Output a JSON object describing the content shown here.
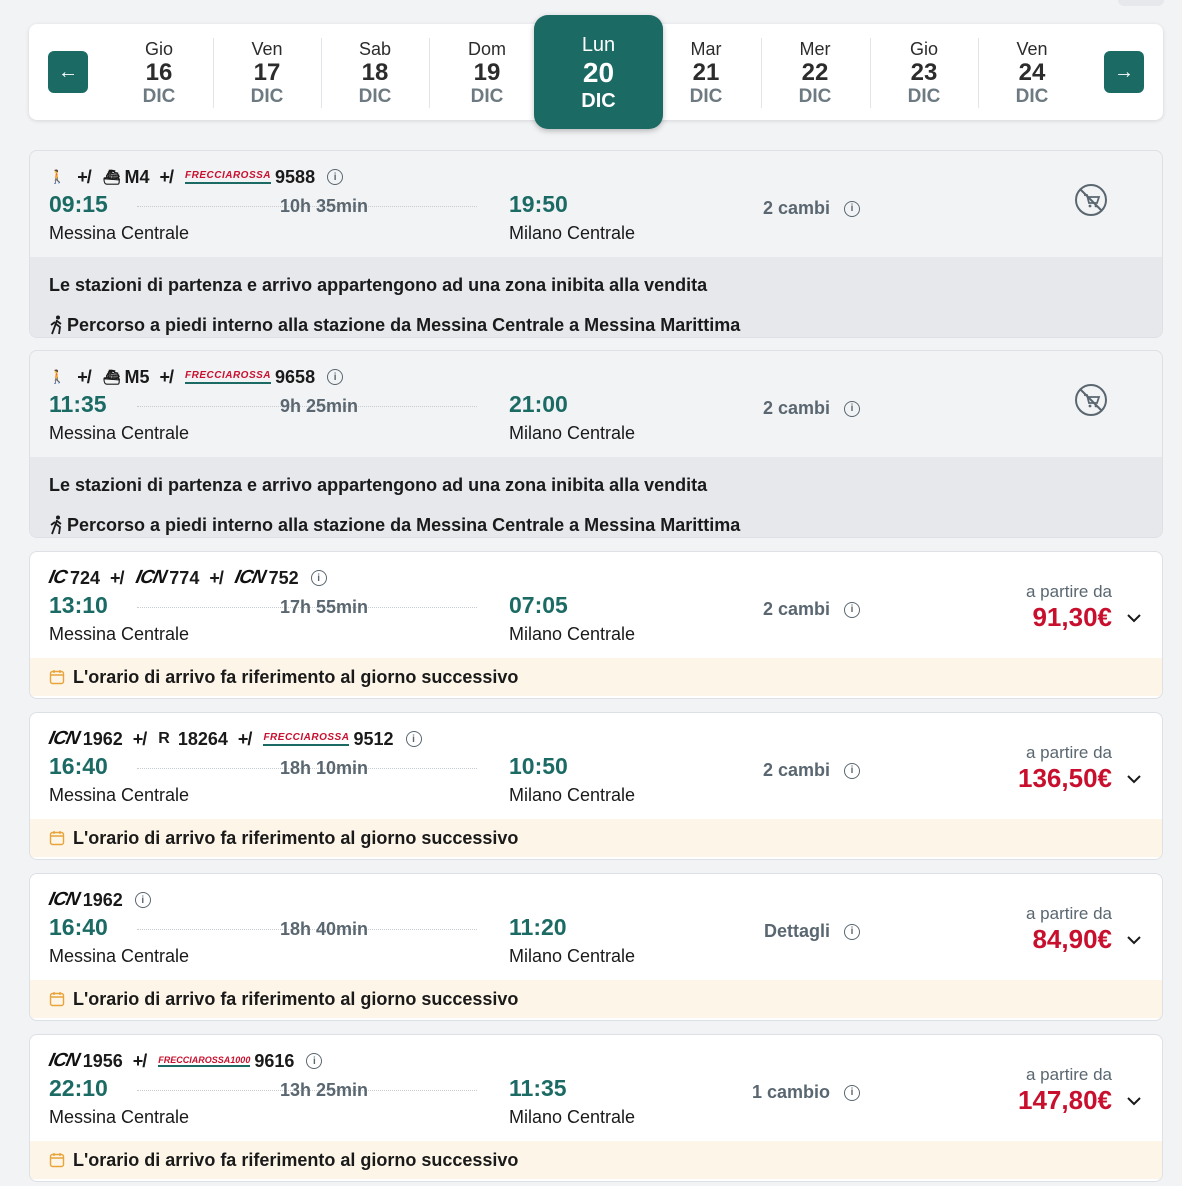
{
  "dates": {
    "prev_label": "←",
    "next_label": "→",
    "items": [
      {
        "dow": "Gio",
        "day": "16",
        "mon": "DIC"
      },
      {
        "dow": "Ven",
        "day": "17",
        "mon": "DIC"
      },
      {
        "dow": "Sab",
        "day": "18",
        "mon": "DIC"
      },
      {
        "dow": "Dom",
        "day": "19",
        "mon": "DIC"
      },
      {
        "dow": "Lun",
        "day": "20",
        "mon": "DIC"
      },
      {
        "dow": "Mar",
        "day": "21",
        "mon": "DIC"
      },
      {
        "dow": "Mer",
        "day": "22",
        "mon": "DIC"
      },
      {
        "dow": "Gio",
        "day": "23",
        "mon": "DIC"
      },
      {
        "dow": "Ven",
        "day": "24",
        "mon": "DIC"
      }
    ]
  },
  "common": {
    "price_label": "a partire da",
    "zone_warning": "Le stazioni di partenza e arrivo appartengono ad una zona inibita alla vendita",
    "walk_note": "Percorso a piedi interno alla stazione da Messina Centrale a Messina Marittima",
    "next_day_note": "L'orario di arrivo fa riferimento al giorno successivo",
    "change_sep": "+/",
    "info_glyph": "i",
    "logo_frecciarossa": "FRECCIAROSSA",
    "logo_frecciarossa1000": "FRECCIAROSSA1000",
    "logo_ic": "IC",
    "logo_icn": "ICN",
    "logo_regionale": "R",
    "ferry_glyph": "⛴",
    "walk_glyph": "🚶"
  },
  "solutions": [
    {
      "seg1": "M4",
      "seg2": "9588",
      "dep_time": "09:15",
      "dep_station": "Messina Centrale",
      "duration": "10h 35min",
      "arr_time": "19:50",
      "arr_station": "Milano Centrale",
      "changes": "2 cambi"
    },
    {
      "seg1": "M5",
      "seg2": "9658",
      "dep_time": "11:35",
      "dep_station": "Messina Centrale",
      "duration": "9h 25min",
      "arr_time": "21:00",
      "arr_station": "Milano Centrale",
      "changes": "2 cambi"
    },
    {
      "seg1": "724",
      "seg2": "774",
      "seg3": "752",
      "dep_time": "13:10",
      "dep_station": "Messina Centrale",
      "duration": "17h 55min",
      "arr_time": "07:05",
      "arr_station": "Milano Centrale",
      "changes": "2 cambi",
      "price": "91,30€"
    },
    {
      "seg1": "1962",
      "seg2": "18264",
      "seg3": "9512",
      "dep_time": "16:40",
      "dep_station": "Messina Centrale",
      "duration": "18h 10min",
      "arr_time": "10:50",
      "arr_station": "Milano Centrale",
      "changes": "2 cambi",
      "price": "136,50€"
    },
    {
      "seg1": "1962",
      "dep_time": "16:40",
      "dep_station": "Messina Centrale",
      "duration": "18h 40min",
      "arr_time": "11:20",
      "arr_station": "Milano Centrale",
      "changes": "Dettagli",
      "price": "84,90€"
    },
    {
      "seg1": "1956",
      "seg2": "9616",
      "dep_time": "22:10",
      "dep_station": "Messina Centrale",
      "duration": "13h 25min",
      "arr_time": "11:35",
      "arr_station": "Milano Centrale",
      "changes": "1 cambio",
      "price": "147,80€"
    }
  ]
}
